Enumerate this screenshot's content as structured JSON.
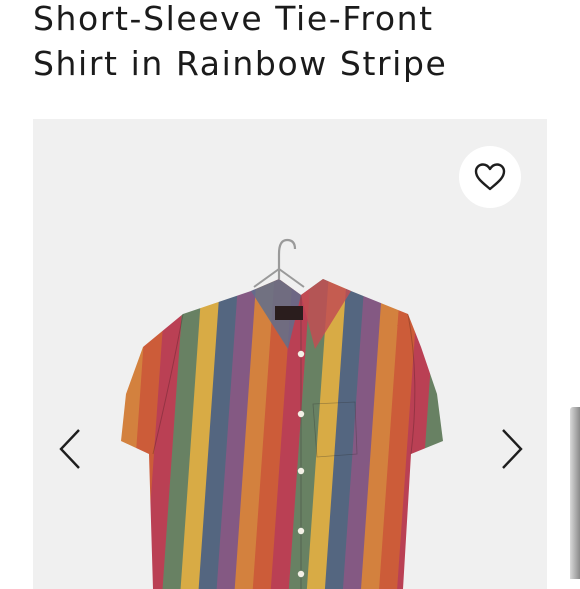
{
  "product": {
    "title_line1": "Short-Sleeve Tie-Front",
    "title_line2": "Shirt in Rainbow Stripe"
  },
  "gallery": {
    "favorite_icon": "heart-icon",
    "prev_icon": "chevron-left-icon",
    "next_icon": "chevron-right-icon",
    "background": "#f0f0f0",
    "stripe_colors": [
      "#d9623d",
      "#c6455a",
      "#6f8a6a",
      "#e6b64a",
      "#5a6d88",
      "#8d5f8c",
      "#e18a42"
    ]
  }
}
